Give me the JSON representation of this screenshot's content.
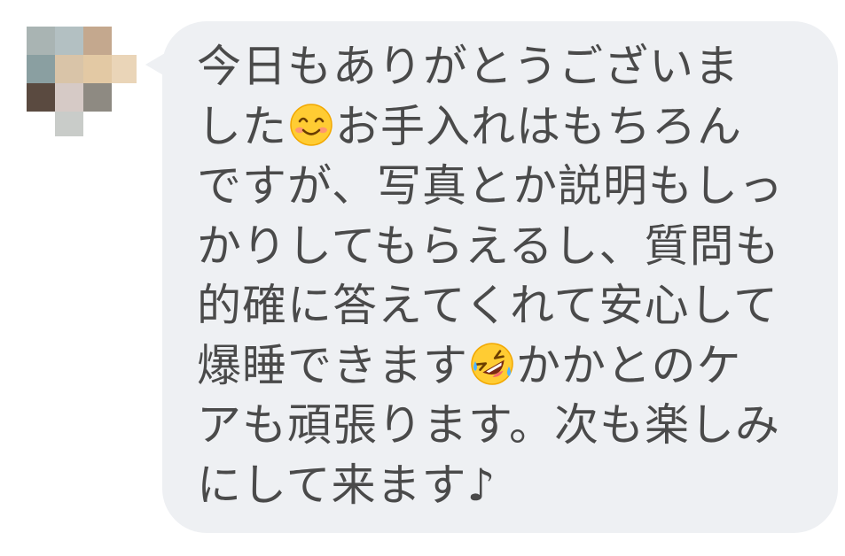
{
  "message": {
    "lines": [
      [
        "今日もありがとうございま"
      ],
      [
        "した",
        {
          "emoji": "smiling-face-icon"
        },
        "お手入れはもちろん"
      ],
      [
        "ですが、写真とか説明もしっ"
      ],
      [
        "かりしてもらえるし、質問も"
      ],
      [
        "的確に答えてくれて安心して"
      ],
      [
        "爆睡できます",
        {
          "emoji": "rolling-laughing-icon"
        },
        "かかとのケ"
      ],
      [
        "アも頑張ります。次も楽しみ"
      ],
      [
        "にして来ます♪"
      ]
    ]
  },
  "colors": {
    "bubble": "#eef0f3",
    "text": "#4a4a4a"
  }
}
